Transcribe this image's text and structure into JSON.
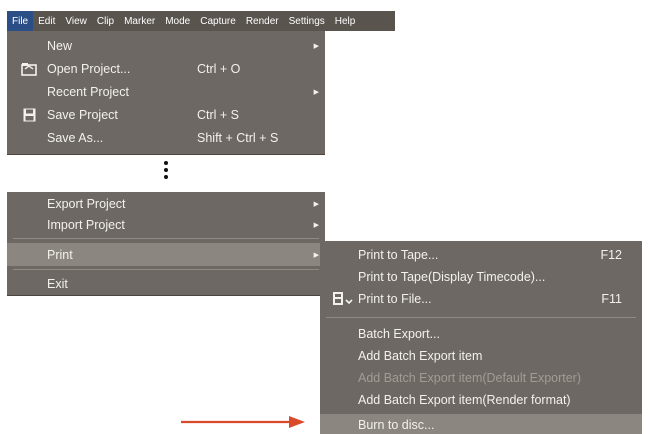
{
  "menubar": {
    "items": [
      "File",
      "Edit",
      "View",
      "Clip",
      "Marker",
      "Mode",
      "Capture",
      "Render",
      "Settings",
      "Help"
    ]
  },
  "file_menu": {
    "group1": [
      {
        "label": "New",
        "shortcut": "",
        "submenu": true,
        "icon": "none"
      },
      {
        "label": "Open Project...",
        "shortcut": "Ctrl + O",
        "submenu": false,
        "icon": "open-folder-icon"
      },
      {
        "label": "Recent Project",
        "shortcut": "",
        "submenu": true,
        "icon": "none"
      },
      {
        "label": "Save Project",
        "shortcut": "Ctrl + S",
        "submenu": false,
        "icon": "floppy-disk-icon"
      },
      {
        "label": "Save As...",
        "shortcut": "Shift + Ctrl + S",
        "submenu": false,
        "icon": "none"
      }
    ],
    "group2": [
      {
        "label": "Export Project",
        "submenu": true
      },
      {
        "label": "Import Project",
        "submenu": true
      },
      {
        "label": "Print",
        "submenu": true,
        "highlighted": true
      },
      {
        "label": "Exit",
        "submenu": false
      }
    ]
  },
  "print_submenu": {
    "items": [
      {
        "label": "Print to Tape...",
        "shortcut": "F12",
        "disabled": false
      },
      {
        "label": "Print to Tape(Display Timecode)...",
        "shortcut": "",
        "disabled": false
      },
      {
        "label": "Print to File...",
        "shortcut": "F11",
        "disabled": false,
        "icon": "print-to-file-icon"
      },
      {
        "label": "Batch Export...",
        "shortcut": "",
        "disabled": false
      },
      {
        "label": "Add Batch Export item",
        "shortcut": "",
        "disabled": false
      },
      {
        "label": "Add Batch Export item(Default Exporter)",
        "shortcut": "",
        "disabled": true
      },
      {
        "label": "Add Batch Export item(Render format)",
        "shortcut": "",
        "disabled": false
      },
      {
        "label": "Burn to disc...",
        "shortcut": "",
        "disabled": false,
        "highlighted": true
      }
    ]
  },
  "colors": {
    "menubar_bg": "#5a544f",
    "menubar_active": "#2c4e86",
    "menu_bg": "#6d6863",
    "highlight": "#8b8680",
    "disabled_text": "#a29c95",
    "callout_arrow": "#d94a2a"
  }
}
